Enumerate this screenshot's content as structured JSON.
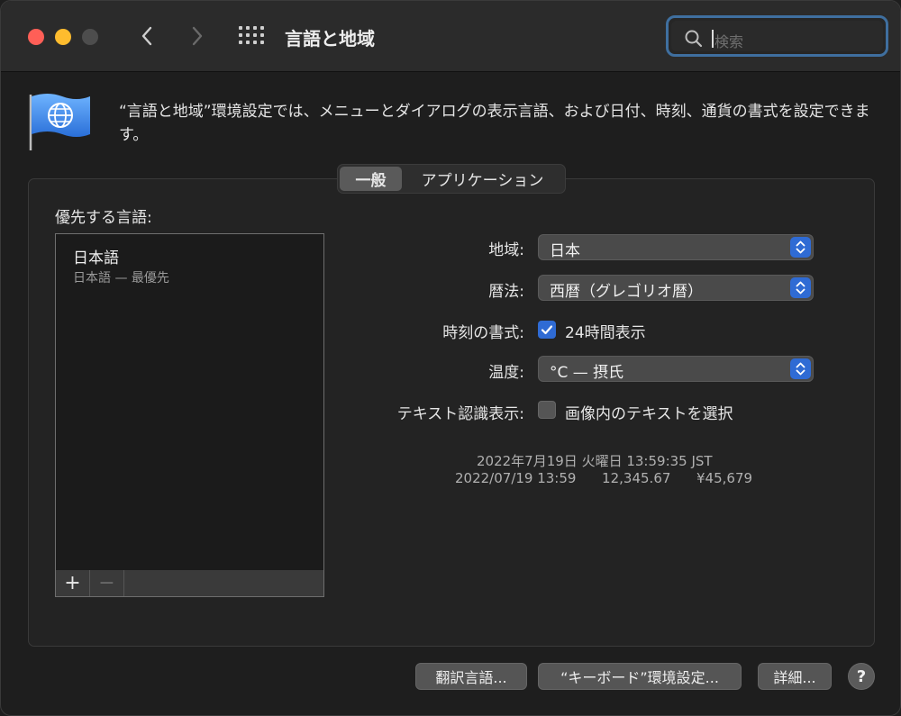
{
  "window": {
    "title": "言語と地域",
    "search": {
      "placeholder": "検索",
      "icon": "search-icon"
    }
  },
  "header": {
    "description": "“言語と地域”環境設定では、メニューとダイアログの表示言語、および日付、時刻、通貨の書式を設定できます。",
    "icon": "globe-flag-icon"
  },
  "tabs": [
    {
      "label": "一般",
      "active": true
    },
    {
      "label": "アプリケーション",
      "active": false
    }
  ],
  "preferred_languages": {
    "label": "優先する言語:",
    "items": [
      {
        "name": "日本語",
        "detail": "日本語 — 最優先"
      }
    ],
    "add_label": "+",
    "remove_label": "−"
  },
  "settings": {
    "region": {
      "label": "地域:",
      "value": "日本"
    },
    "calendar": {
      "label": "暦法:",
      "value": "西暦（グレゴリオ暦）"
    },
    "time_format": {
      "label": "時刻の書式:",
      "checkbox_label": "24時間表示",
      "checked": true
    },
    "temperature": {
      "label": "温度:",
      "value": "°C — 摂氏"
    },
    "live_text": {
      "label": "テキスト認識表示:",
      "checkbox_label": "画像内のテキストを選択",
      "checked": false
    }
  },
  "sample": {
    "line1": "2022年7月19日 火曜日 13:59:35 JST",
    "line2": "2022/07/19 13:59      12,345.67      ¥45,679"
  },
  "buttons": {
    "translate": "翻訳言語...",
    "keyboard": "“キーボード”環境設定...",
    "advanced": "詳細...",
    "help": "?"
  },
  "colors": {
    "accent": "#2f6bd4",
    "close": "#ff5f57",
    "minimize": "#febc2e",
    "focus_ring": "#3f6f9f"
  }
}
